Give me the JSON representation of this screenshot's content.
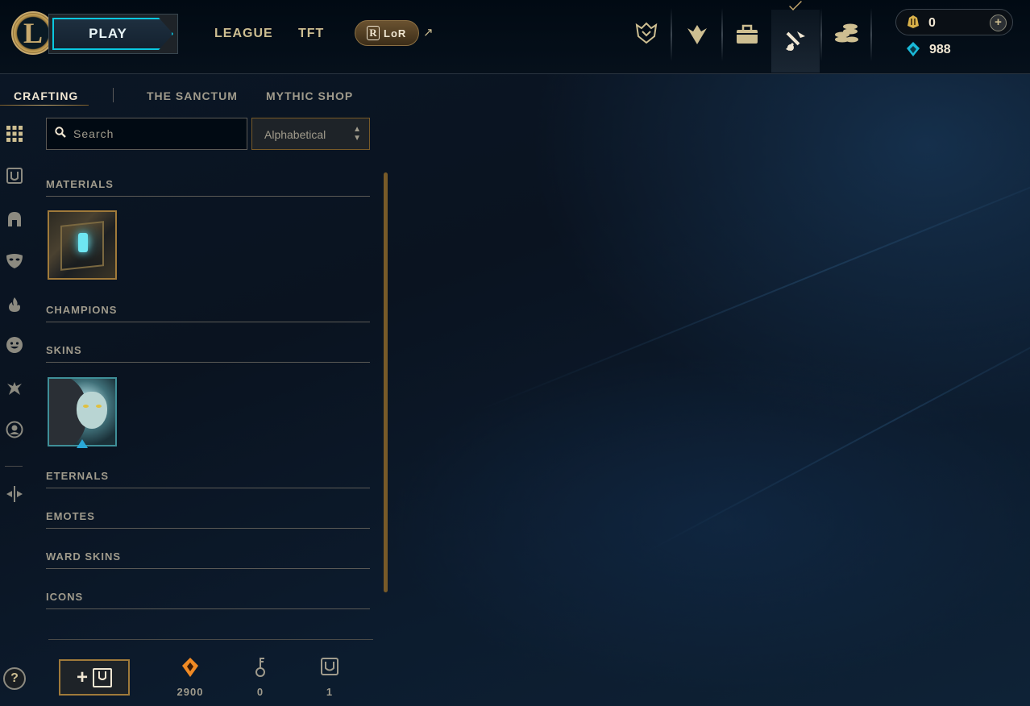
{
  "topnav": {
    "logo_letter": "L",
    "play_label": "PLAY",
    "league_label": "LEAGUE",
    "tft_label": "TFT",
    "lor_label": "LoR",
    "lor_badge": "R",
    "external_icon": "external-link-icon",
    "icons": [
      "worlds-trophy-icon",
      "ranked-wings-icon",
      "collection-bag-icon",
      "loot-crafting-icon",
      "store-coins-icon"
    ],
    "active_icon": "loot-crafting-icon"
  },
  "currency": {
    "rp_value": "0",
    "be_value": "988",
    "rp_color": "#d9b14a",
    "be_color": "#19b9d8"
  },
  "subnav": {
    "tabs": [
      "CRAFTING",
      "THE SANCTUM",
      "MYTHIC SHOP"
    ],
    "active": "CRAFTING"
  },
  "rail": {
    "icons": [
      "all-loot-grid-icon",
      "chest-filter-icon",
      "champion-helmet-icon",
      "skin-mask-icon",
      "eternals-flame-icon",
      "emote-face-icon",
      "ward-icon",
      "summoner-icon-filter-icon",
      "misc-arrows-icon"
    ],
    "help_label": "?"
  },
  "filter": {
    "search_placeholder": "Search",
    "sort_value": "Alphabetical"
  },
  "categories": [
    "MATERIALS",
    "CHAMPIONS",
    "SKINS",
    "ETERNALS",
    "EMOTES",
    "WARD SKINS",
    "ICONS"
  ],
  "footer": {
    "add_chest_plus": "+",
    "orange_essence": "2900",
    "keys": "0",
    "chests": "1",
    "orange_color": "#f08a24"
  }
}
